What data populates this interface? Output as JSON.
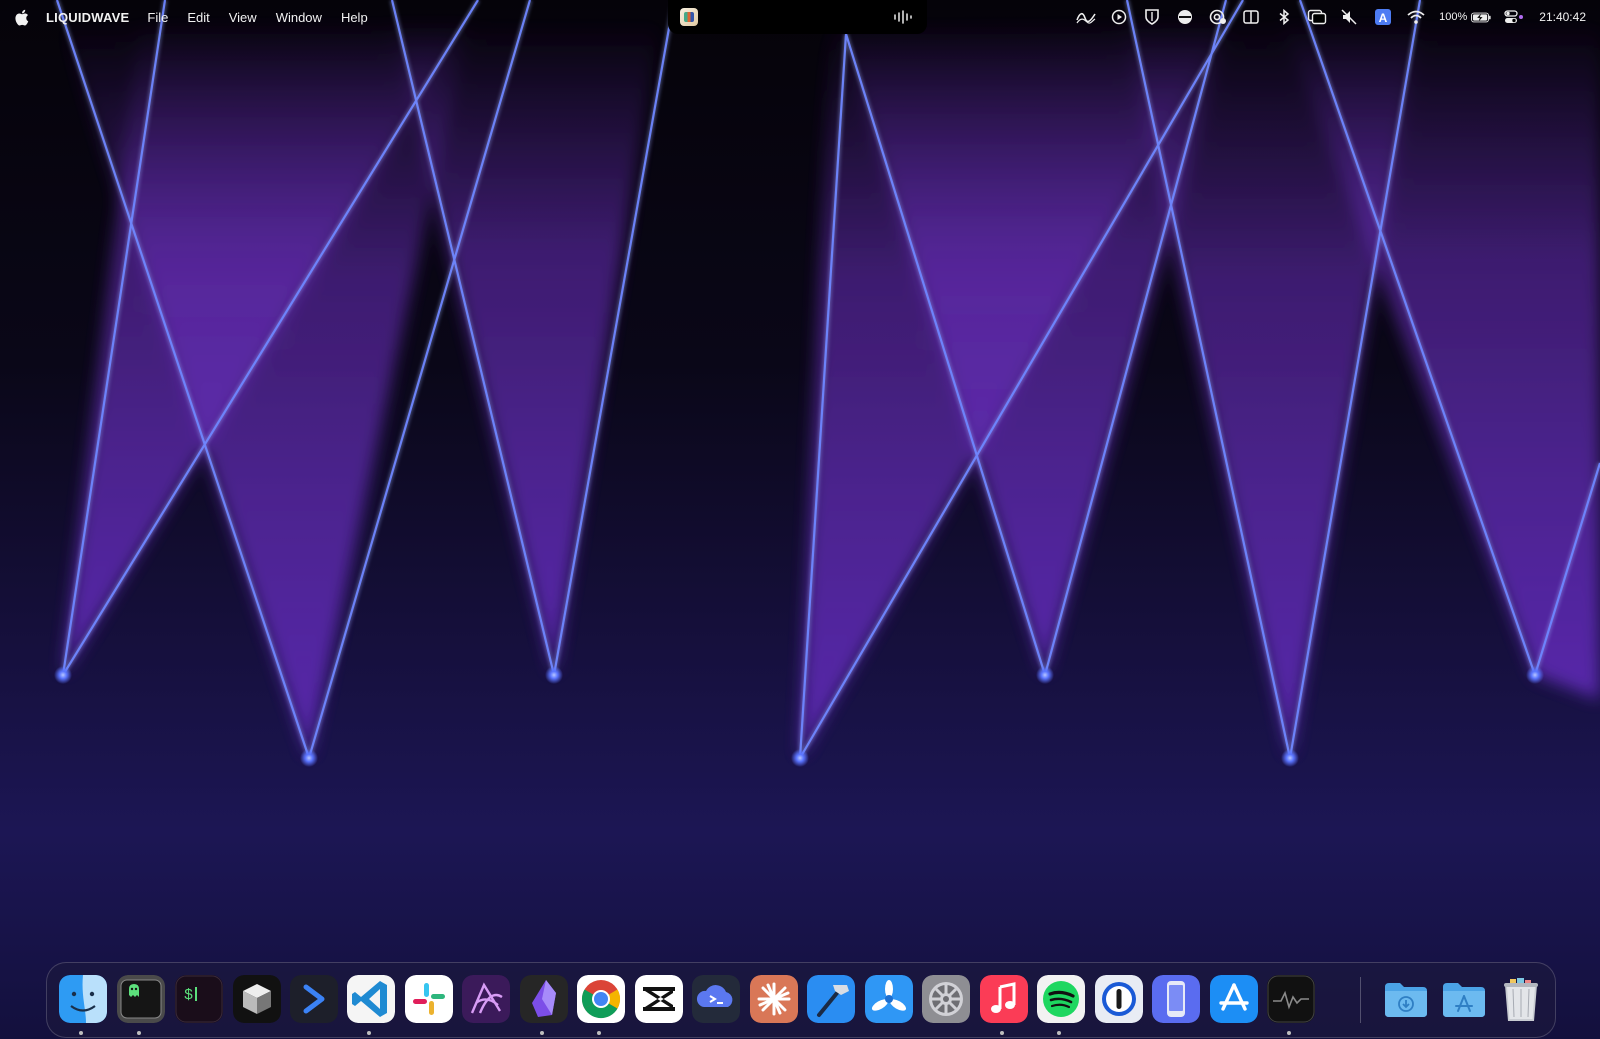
{
  "menubar": {
    "apple_icon": "apple-logo-icon",
    "app_name": "LIQUIDWAVE",
    "menus": [
      "File",
      "Edit",
      "View",
      "Window",
      "Help"
    ],
    "status": {
      "battery_percent": "100%",
      "time": "21:40:42"
    },
    "status_icons": [
      "wave-icon",
      "play-icon",
      "bitwarden-icon",
      "dash-icon",
      "at-sign-icon",
      "book-icon",
      "bluetooth-icon",
      "window-stack-icon",
      "mute-icon",
      "input-source-icon",
      "wifi-icon",
      "battery-icon",
      "control-center-icon"
    ]
  },
  "notch": {
    "app_icon": "media-app-icon",
    "wave_icon": "audio-wave-icon"
  },
  "dock": {
    "apps": [
      {
        "icon": "finder-icon",
        "running": true
      },
      {
        "icon": "ghostty-terminal-icon",
        "running": true
      },
      {
        "icon": "terminal-icon",
        "running": false
      },
      {
        "icon": "cube-app-icon",
        "running": false
      },
      {
        "icon": "prompt-arrow-icon",
        "running": false
      },
      {
        "icon": "vscode-icon",
        "running": true
      },
      {
        "icon": "slack-icon",
        "running": false
      },
      {
        "icon": "affinity-icon",
        "running": false
      },
      {
        "icon": "obsidian-icon",
        "running": true
      },
      {
        "icon": "chrome-icon",
        "running": true
      },
      {
        "icon": "capcut-icon",
        "running": false
      },
      {
        "icon": "cloud-terminal-icon",
        "running": false
      },
      {
        "icon": "claude-icon",
        "running": false
      },
      {
        "icon": "xcode-hammer-icon",
        "running": false
      },
      {
        "icon": "fan-app-icon",
        "running": false
      },
      {
        "icon": "system-settings-icon",
        "running": false
      },
      {
        "icon": "music-icon",
        "running": true
      },
      {
        "icon": "spotify-icon",
        "running": true
      },
      {
        "icon": "1password-icon",
        "running": false
      },
      {
        "icon": "simulator-icon",
        "running": false
      },
      {
        "icon": "app-store-icon",
        "running": false
      },
      {
        "icon": "activity-monitor-icon",
        "running": true
      }
    ],
    "stacks": [
      {
        "icon": "downloads-folder-icon"
      },
      {
        "icon": "applications-folder-icon"
      },
      {
        "icon": "trash-icon"
      }
    ]
  },
  "colors": {
    "beam": "#5a74ff",
    "glow": "#8a3de0",
    "background_bottom": "#1c1654"
  }
}
